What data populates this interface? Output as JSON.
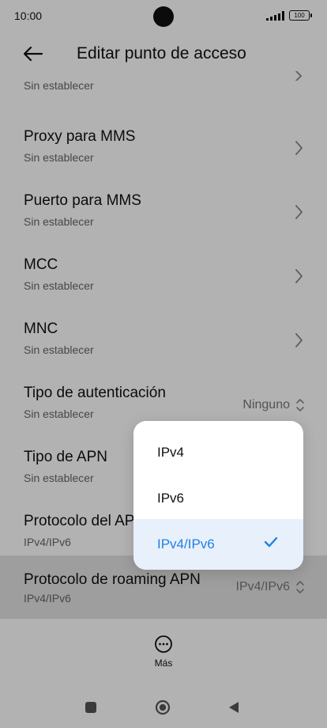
{
  "status": {
    "time": "10:00",
    "battery": "100"
  },
  "header": {
    "title": "Editar punto de acceso"
  },
  "partial_row": {
    "subtitle": "Sin establecer"
  },
  "rows": [
    {
      "title": "Proxy para MMS",
      "subtitle": "Sin establecer"
    },
    {
      "title": "Puerto para MMS",
      "subtitle": "Sin establecer"
    },
    {
      "title": "MCC",
      "subtitle": "Sin establecer"
    },
    {
      "title": "MNC",
      "subtitle": "Sin establecer"
    },
    {
      "title": "Tipo de autenticación",
      "subtitle": "Sin establecer",
      "value": "Ninguno"
    },
    {
      "title": "Tipo de APN",
      "subtitle": "Sin establecer"
    },
    {
      "title": "Protocolo del APN",
      "subtitle": "IPv4/IPv6"
    },
    {
      "title": "Protocolo de roaming APN",
      "subtitle": "IPv4/IPv6",
      "value": "IPv4/IPv6"
    }
  ],
  "bottom": {
    "more_label": "Más"
  },
  "popup": {
    "options": [
      "IPv4",
      "IPv6",
      "IPv4/IPv6"
    ],
    "selected": "IPv4/IPv6",
    "accent_color": "#1f80e6"
  }
}
